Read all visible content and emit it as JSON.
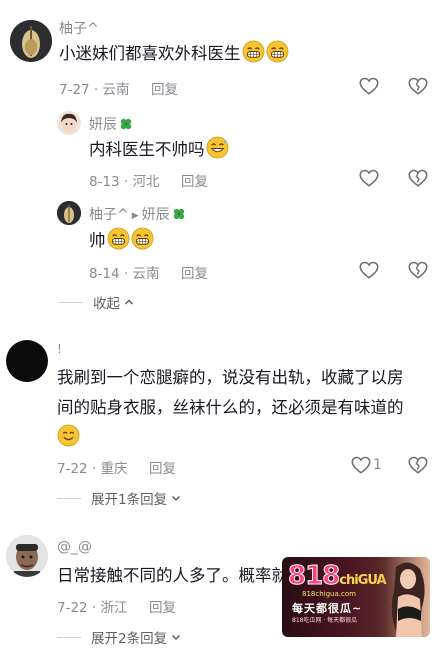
{
  "comments": [
    {
      "user": "柚子^",
      "text": "小迷妹们都喜欢外科医生",
      "date": "7-27",
      "location": "云南",
      "reply": "回复",
      "like_count": "",
      "replies": [
        {
          "user": "妍辰",
          "text": "内科医生不帅吗",
          "date": "8-13",
          "location": "河北",
          "reply": "回复"
        },
        {
          "user": "柚子^",
          "reply_to": "妍辰",
          "text": "帅",
          "date": "8-14",
          "location": "云南",
          "reply": "回复"
        }
      ],
      "collapse_label": "收起"
    },
    {
      "user": "!",
      "text_line1": "我刷到一个恋腿癖的，说没有出轨，收藏了以房",
      "text_line2": "间的贴身衣服，丝袜什么的，还必须是有味道的",
      "date": "7-22",
      "location": "重庆",
      "reply": "回复",
      "like_count": "1",
      "expand_label": "展开1条回复"
    },
    {
      "user": "@_@",
      "text": "日常接触不同的人多了。概率就",
      "date": "7-22",
      "location": "浙江",
      "reply": "回复",
      "expand_label": "展开2条回复"
    }
  ],
  "watermark": {
    "logo": "818",
    "logo_suffix": "chiGUA",
    "url": "818chigua.com",
    "slogan": "每天都很瓜~",
    "sub": "818吃瓜网 · 每天都很瓜"
  },
  "icons": {
    "like": "heart-outline-icon",
    "dislike": "broken-heart-icon",
    "expand": "chevron-down-icon",
    "collapse": "chevron-up-icon",
    "emoji": "grinning-emoji-icon",
    "badge": "clover-icon"
  },
  "colors": {
    "text": "#161823",
    "meta": "#8a8b91",
    "emoji": "#f7c531"
  }
}
